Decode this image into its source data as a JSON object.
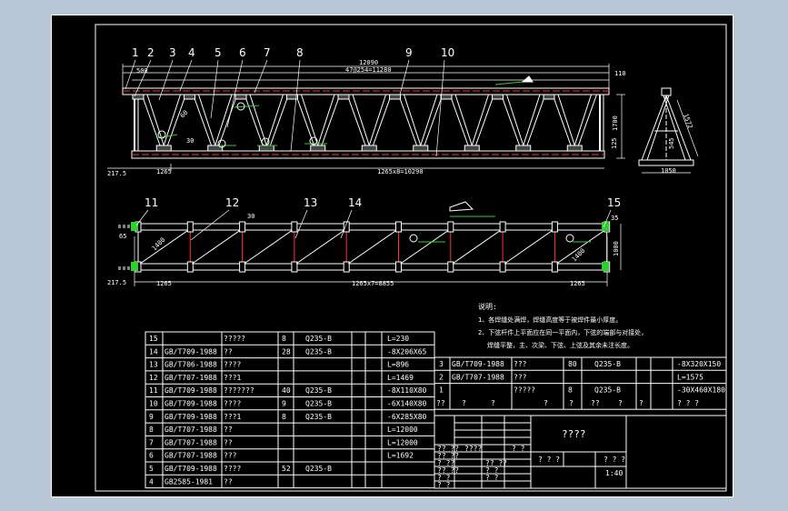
{
  "balloons_top": [
    "1",
    "2",
    "3",
    "4",
    "5",
    "6",
    "7",
    "8",
    "9",
    "10"
  ],
  "balloons_bottom": [
    "11",
    "12",
    "13",
    "14",
    "15"
  ],
  "elevation_dims": {
    "total": "12090",
    "top_span": "47@254=11280",
    "left_top": "500",
    "right_top": "110",
    "height": "1700",
    "small_right": "125",
    "bottom_left": "217.5",
    "bottom_bay": "1265",
    "bottom_span": "1265x8=10290",
    "angle1": "60",
    "angle2": "30"
  },
  "section_dims": {
    "width": "1050",
    "height": "545",
    "slant": "1572"
  },
  "plan_dims": {
    "left_small": "65",
    "top_mark": "30",
    "right_mark": "35",
    "right_height": "1000",
    "bottom_left": "217.5",
    "bottom_bay": "1265",
    "bottom_span": "1265x7=8855",
    "bottom_right": "1265",
    "diag_left": "1400",
    "diag_right": "1400"
  },
  "notes": {
    "title": "说明:",
    "line1": "1、各焊缝处满焊，焊缝高度等于被焊件最小厚度。",
    "line2": "2、下弦杆件上平面应在同一平面内，下弦的端部与对接处，",
    "line3": "焊缝平整，主、次梁、下弦、上弦及其余未注长度。"
  },
  "parts_list": [
    {
      "no": "15",
      "std": "",
      "name": "?????",
      "qty": "8",
      "mat": "Q235-B",
      "spec": "L=230"
    },
    {
      "no": "14",
      "std": "GB/T709-1988",
      "name": "??",
      "qty": "28",
      "mat": "Q235-B",
      "spec": "-8X206X65"
    },
    {
      "no": "13",
      "std": "GB/T706-1988",
      "name": "????",
      "qty": "",
      "mat": "",
      "spec": "L=896"
    },
    {
      "no": "12",
      "std": "GB/T707-1988",
      "name": "???1",
      "qty": "",
      "mat": "",
      "spec": "L=1469"
    },
    {
      "no": "11",
      "std": "GB/T709-1988",
      "name": "???????",
      "qty": "40",
      "mat": "Q235-B",
      "spec": "-8X110X80"
    },
    {
      "no": "10",
      "std": "GB/T709-1988",
      "name": "????",
      "qty": "9",
      "mat": "Q235-B",
      "spec": "-6X140X80"
    },
    {
      "no": "9",
      "std": "GB/T709-1988",
      "name": "???1",
      "qty": "8",
      "mat": "Q235-B",
      "spec": "-6X285X80"
    },
    {
      "no": "8",
      "std": "GB/T707-1988",
      "name": "??",
      "qty": "",
      "mat": "",
      "spec": "L=12000"
    },
    {
      "no": "7",
      "std": "GB/T707-1988",
      "name": "??",
      "qty": "",
      "mat": "",
      "spec": "L=12000"
    },
    {
      "no": "6",
      "std": "GB/T707-1988",
      "name": "???",
      "qty": "",
      "mat": "",
      "spec": "L=1692"
    },
    {
      "no": "5",
      "std": "GB/T709-1988",
      "name": "????",
      "qty": "52",
      "mat": "Q235-B",
      "spec": ""
    },
    {
      "no": "4",
      "std": "GB2585-1981",
      "name": "??",
      "qty": "",
      "mat": "",
      "spec": ""
    }
  ],
  "parts_list_right": [
    {
      "no": "3",
      "std": "GB/T709-1988",
      "name": "???",
      "qty": "80",
      "mat": "Q235-B",
      "spec": "-8X320X150"
    },
    {
      "no": "2",
      "std": "GB/T707-1988",
      "name": "???",
      "qty": "",
      "mat": "",
      "spec": "L=1575"
    },
    {
      "no": "1",
      "std": "",
      "name": "?????",
      "qty": "8",
      "mat": "Q235-B",
      "spec": "-30X460X180"
    }
  ],
  "header_row": [
    "??",
    "?",
    "?",
    "?",
    "?",
    "??",
    "?",
    "?",
    "? ? ?"
  ],
  "title_block": {
    "drawing_name": "????",
    "scale": "1:40",
    "r1": "?? ??",
    "r2": "????",
    "r3": "????",
    "c1": "?? ??",
    "c2": "? ??",
    "c3": "?? ??",
    "c4": "? ?",
    "c5": "?? ??",
    "c6": "? ?",
    "c7": "? ? ?",
    "c8": "? ?",
    "c9": "? ?",
    "c10": "? ?",
    "c11": "? ? ?"
  }
}
